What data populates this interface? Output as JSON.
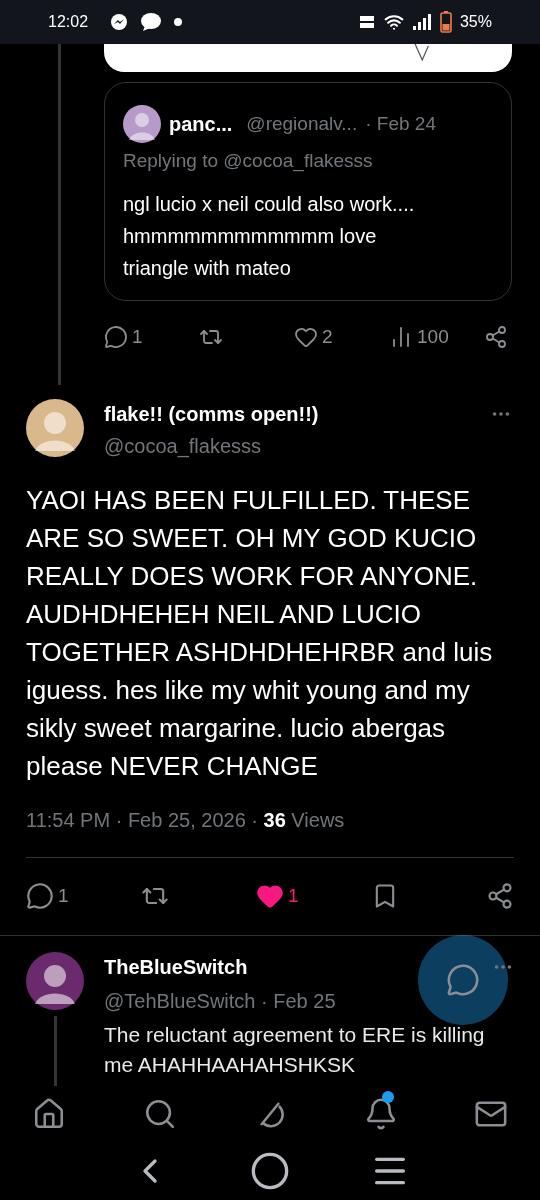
{
  "status_bar": {
    "time": "12:02",
    "battery": "35%",
    "notifications": [
      {
        "kind": "messenger"
      },
      {
        "kind": "chat"
      },
      {
        "kind": "dot"
      }
    ]
  },
  "quote_tweet": {
    "name": "panc...",
    "handle": "@regionalv...",
    "date": "· Feb 24",
    "replying_to": "Replying to @cocoa_flakesss",
    "text": "ngl lucio x neil could also work.... hmmmmmmmmmmmm love triangle with mateo",
    "actions": [
      {
        "kind": "reply",
        "count": "1"
      },
      {
        "kind": "repost"
      },
      {
        "kind": "like",
        "count": "2",
        "liked": false
      },
      {
        "kind": "views",
        "count": "100"
      },
      {
        "kind": "share"
      }
    ]
  },
  "main_tweet": {
    "name": "flake!! (comms open!!)",
    "handle": "@cocoa_flakesss",
    "text": "YAOI HAS BEEN FULFILLED. THESE ARE SO SWEET. OH MY GOD KUCIO REALLY DOES WORK FOR ANYONE. AUDHDHEHEH NEIL AND LUCIO TOGETHER ASHDHDHEHRBR and luis iguess. hes like my whit young and my sikly sweet margarine. lucio abergas please NEVER CHANGE",
    "timestamp": "11:54 PM · Feb 25, 2026 ·",
    "views_count": "36",
    "views_label": "Views",
    "actions": [
      {
        "kind": "reply",
        "count": "1"
      },
      {
        "kind": "repost"
      },
      {
        "kind": "like",
        "count": "1",
        "liked": true
      },
      {
        "kind": "bookmark"
      },
      {
        "kind": "share"
      }
    ]
  },
  "reply": {
    "name": "TheBlueSwitch",
    "handle": "@TehBlueSwitch",
    "date": "· Feb 25",
    "text": "The reluctant agreement to ERE is killing me AHAHHAAHAHSHKSK"
  },
  "bottom_nav": [
    {
      "kind": "home",
      "badge": false
    },
    {
      "kind": "search",
      "badge": false
    },
    {
      "kind": "grok",
      "badge": false
    },
    {
      "kind": "notifications",
      "badge": true
    },
    {
      "kind": "messages",
      "badge": false
    }
  ],
  "system_nav": [
    {
      "kind": "back"
    },
    {
      "kind": "home"
    },
    {
      "kind": "recents"
    }
  ]
}
